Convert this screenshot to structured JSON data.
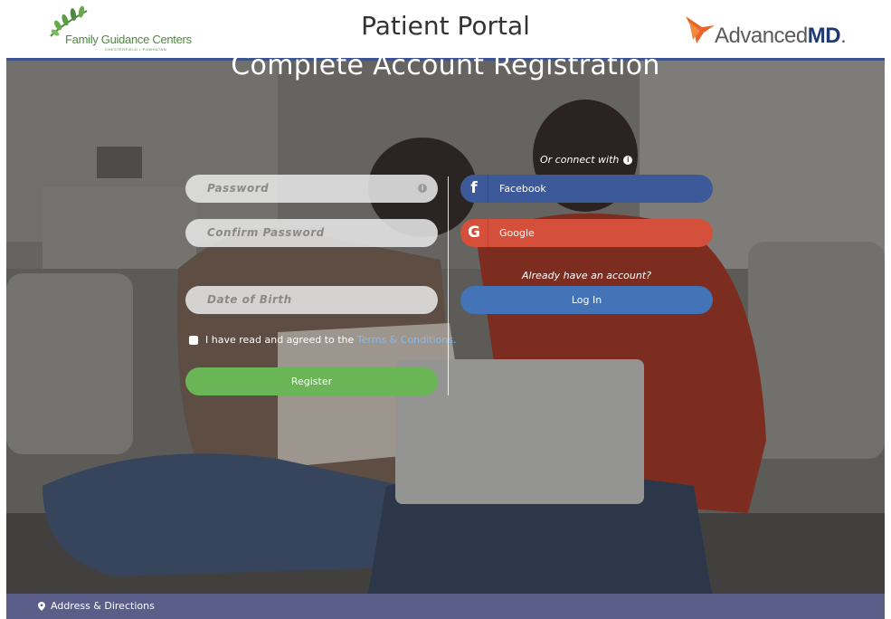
{
  "header": {
    "left_logo": {
      "name": "Family Guidance Centers",
      "subtitle": "CHESTERFIELD • POWHATAN",
      "icon": "leaves-logo-icon"
    },
    "title": "Patient Portal",
    "right_logo": {
      "name_regular": "Advanced",
      "name_bold": "MD",
      "suffix": ".",
      "icon": "advancedmd-bird-logo-icon"
    }
  },
  "registration": {
    "title": "Complete Account Registration",
    "fields": {
      "password_placeholder": "Password",
      "confirm_password_placeholder": "Confirm Password",
      "dob_placeholder": "Date of Birth"
    },
    "terms": {
      "text": "I have read and agreed to the ",
      "link": "Terms & Conditions."
    },
    "register_label": "Register"
  },
  "social": {
    "connect_label": "Or connect with",
    "facebook_label": "Facebook",
    "google_label": "Google",
    "already_label": "Already have an account?",
    "login_label": "Log In"
  },
  "footer": {
    "address_label": "Address & Directions"
  },
  "colors": {
    "header_rule": "#3d5390",
    "register": "#6ab657",
    "facebook": "#3c5a99",
    "google": "#d5503b",
    "login": "#4474b8",
    "footer": "#5a5e88",
    "terms_link": "#8ab8e8"
  }
}
